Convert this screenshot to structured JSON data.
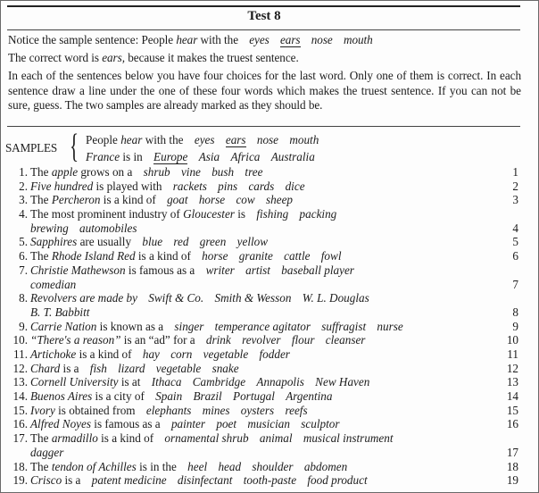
{
  "title": "Test 8",
  "instructions": {
    "sample_prefix": "Notice the sample sentence: People ",
    "sample_italic": "hear",
    "sample_mid": " with the",
    "sample_choices": [
      "eyes",
      "ears",
      "nose",
      "mouth"
    ],
    "sample_answer_index": 1,
    "correct_prefix": "The correct word is ",
    "correct_word": "ears,",
    "correct_suffix": " because it makes the truest sentence.",
    "paragraph": "In each of the sentences below you have four choices for the last word. Only one of them is correct. In each sentence draw a line under the one of these four words which makes the truest sentence. If you can not be sure, guess. The two samples are already marked as they should be."
  },
  "samples": {
    "label": "SAMPLES",
    "rows": [
      {
        "subject": "People ",
        "subject_italic": "hear",
        "rest": " with the",
        "choices": [
          "eyes",
          "ears",
          "nose",
          "mouth"
        ],
        "underlined_index": 1
      },
      {
        "subject_italic": "France",
        "rest": " is in",
        "choices": [
          "Europe",
          "Asia",
          "Africa",
          "Australia"
        ],
        "underlined_index": 0
      }
    ]
  },
  "items": [
    {
      "n": "1.",
      "pre": "The ",
      "it": "apple",
      "post": " grows on a",
      "choices": [
        "shrub",
        "vine",
        "bush",
        "tree"
      ],
      "wrap": [],
      "r": "1"
    },
    {
      "n": "2.",
      "pre": "",
      "it": "Five hundred",
      "post": " is played with",
      "choices": [
        "rackets",
        "pins",
        "cards",
        "dice"
      ],
      "wrap": [],
      "r": "2"
    },
    {
      "n": "3.",
      "pre": "The ",
      "it": "Percheron",
      "post": " is a kind of",
      "choices": [
        "goat",
        "horse",
        "cow",
        "sheep"
      ],
      "wrap": [],
      "r": "3"
    },
    {
      "n": "4.",
      "pre": "The most prominent industry of ",
      "it": "Gloucester",
      "post": " is",
      "choices": [
        "fishing",
        "packing"
      ],
      "wrap": [
        "brewing",
        "automobiles"
      ],
      "r": "4"
    },
    {
      "n": "5.",
      "pre": "",
      "it": "Sapphires",
      "post": " are usually",
      "choices": [
        "blue",
        "red",
        "green",
        "yellow"
      ],
      "wrap": [],
      "r": "5"
    },
    {
      "n": "6.",
      "pre": "The ",
      "it": "Rhode Island Red",
      "post": " is a kind of",
      "choices": [
        "horse",
        "granite",
        "cattle",
        "fowl"
      ],
      "wrap": [],
      "r": "6"
    },
    {
      "n": "7.",
      "pre": "",
      "it": "Christie Mathewson",
      "post": " is famous as a",
      "choices": [
        "writer",
        "artist",
        "baseball player"
      ],
      "wrap": [
        "comedian"
      ],
      "r": "7"
    },
    {
      "n": "8.",
      "pre": "",
      "it": "Revolvers are made by",
      "post": "",
      "choices": [
        "Swift & Co.",
        "Smith & Wesson",
        "W. L. Douglas"
      ],
      "wrap": [
        "B. T. Babbitt"
      ],
      "r": "8"
    },
    {
      "n": "9.",
      "pre": "",
      "it": "Carrie Nation",
      "post": " is known as a",
      "choices": [
        "singer",
        "temperance agitator",
        "suffragist",
        "nurse"
      ],
      "wrap": [],
      "r": "9"
    },
    {
      "n": "10.",
      "pre": "",
      "it": "“There's a reason”",
      "post": " is an “ad” for a",
      "choices": [
        "drink",
        "revolver",
        "flour",
        "cleanser"
      ],
      "wrap": [],
      "r": "10"
    },
    {
      "n": "11.",
      "pre": "",
      "it": "Artichoke",
      "post": " is a kind of",
      "choices": [
        "hay",
        "corn",
        "vegetable",
        "fodder"
      ],
      "wrap": [],
      "r": "11"
    },
    {
      "n": "12.",
      "pre": "",
      "it": "Chard",
      "post": " is a",
      "choices": [
        "fish",
        "lizard",
        "vegetable",
        "snake"
      ],
      "wrap": [],
      "r": "12"
    },
    {
      "n": "13.",
      "pre": "",
      "it": "Cornell University",
      "post": " is at",
      "choices": [
        "Ithaca",
        "Cambridge",
        "Annapolis",
        "New Haven"
      ],
      "wrap": [],
      "r": "13"
    },
    {
      "n": "14.",
      "pre": "",
      "it": "Buenos Aires",
      "post": " is a city of",
      "choices": [
        "Spain",
        "Brazil",
        "Portugal",
        "Argentina"
      ],
      "wrap": [],
      "r": "14"
    },
    {
      "n": "15.",
      "pre": "",
      "it": "Ivory",
      "post": " is obtained from",
      "choices": [
        "elephants",
        "mines",
        "oysters",
        "reefs"
      ],
      "wrap": [],
      "r": "15"
    },
    {
      "n": "16.",
      "pre": "",
      "it": "Alfred Noyes",
      "post": " is famous as a",
      "choices": [
        "painter",
        "poet",
        "musician",
        "sculptor"
      ],
      "wrap": [],
      "r": "16"
    },
    {
      "n": "17.",
      "pre": "The ",
      "it": "armadillo",
      "post": " is a kind of",
      "choices": [
        "ornamental shrub",
        "animal",
        "musical instrument"
      ],
      "wrap": [
        "dagger"
      ],
      "r": "17"
    },
    {
      "n": "18.",
      "pre": "The ",
      "it": "tendon of Achilles",
      "post": " is in the",
      "choices": [
        "heel",
        "head",
        "shoulder",
        "abdomen"
      ],
      "wrap": [],
      "r": "18"
    },
    {
      "n": "19.",
      "pre": "",
      "it": "Crisco",
      "post": " is a",
      "choices": [
        "patent medicine",
        "disinfectant",
        "tooth-paste",
        "food product"
      ],
      "wrap": [],
      "r": "19"
    }
  ]
}
